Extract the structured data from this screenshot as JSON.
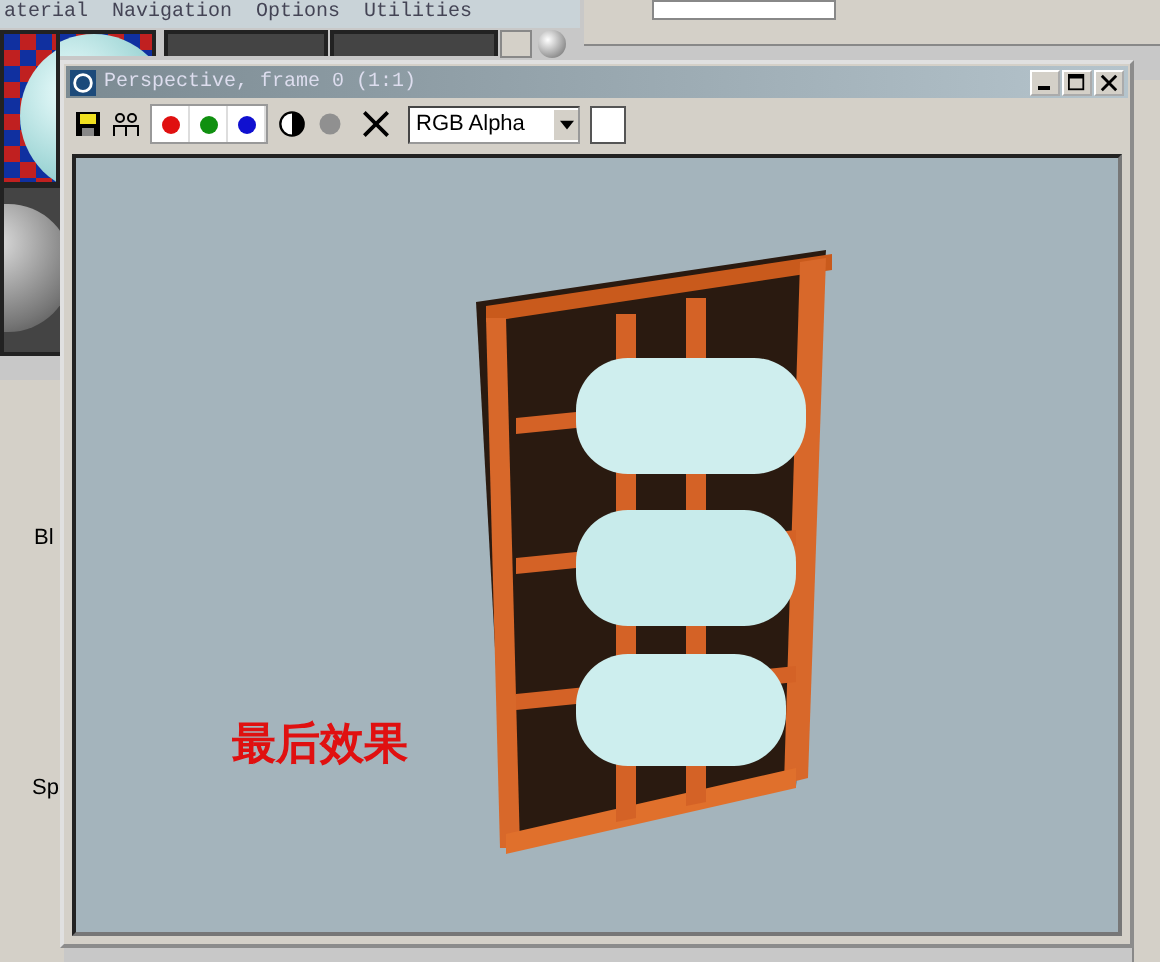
{
  "menu": [
    "aterial",
    "Navigation",
    "Options",
    "Utilities"
  ],
  "side_labels": [
    "Bl",
    "Sp"
  ],
  "window": {
    "title": "Perspective, frame 0 (1:1)"
  },
  "channels": [
    {
      "color": "#e01010",
      "on": true
    },
    {
      "color": "#109010",
      "on": true
    },
    {
      "color": "#1010d0",
      "on": true
    }
  ],
  "channel_select": {
    "value": "RGB Alpha"
  },
  "caption": "最后效果"
}
